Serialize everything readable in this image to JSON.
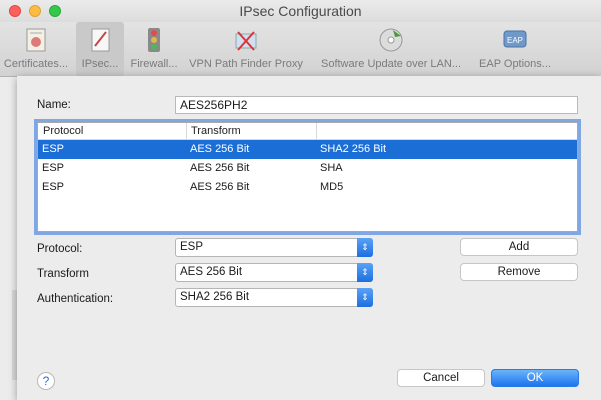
{
  "window": {
    "title": "IPsec Configuration"
  },
  "toolbar": {
    "items": [
      {
        "label": "Certificates..."
      },
      {
        "label": "IPsec..."
      },
      {
        "label": "Firewall..."
      },
      {
        "label": "VPN Path Finder Proxy"
      },
      {
        "label": "Software Update over LAN..."
      },
      {
        "label": "EAP Options..."
      }
    ]
  },
  "form": {
    "name_label": "Name:",
    "name_value": "AES256PH2",
    "protocol_label": "Protocol:",
    "protocol_value": "ESP",
    "transform_label": "Transform",
    "transform_value": "AES 256 Bit",
    "authentication_label": "Authentication:",
    "authentication_value": "SHA2 256 Bit"
  },
  "table": {
    "columns": [
      "Protocol",
      "Transform",
      ""
    ],
    "rows": [
      [
        "ESP",
        "AES 256 Bit",
        "SHA2 256 Bit"
      ],
      [
        "ESP",
        "AES 256 Bit",
        "SHA"
      ],
      [
        "ESP",
        "AES 256 Bit",
        "MD5"
      ]
    ],
    "selected_row": 0
  },
  "buttons": {
    "add": "Add",
    "remove": "Remove",
    "cancel": "Cancel",
    "ok": "OK",
    "help": "?"
  },
  "colors": {
    "accent": "#1c6ed7",
    "selection": "#1c6ed7"
  }
}
